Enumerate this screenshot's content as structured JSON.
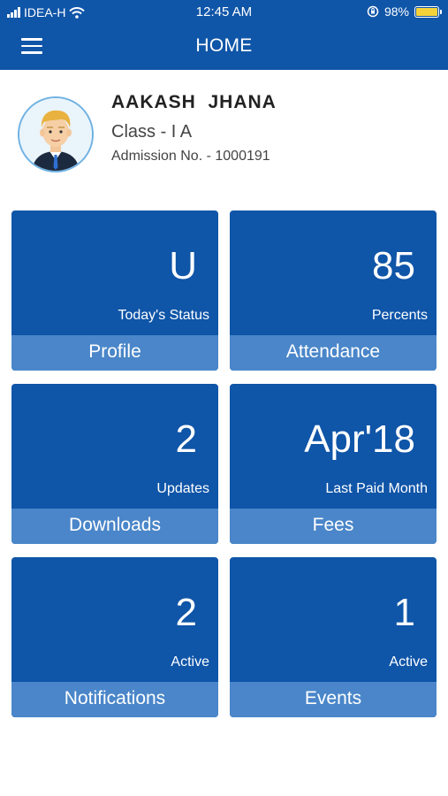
{
  "status_bar": {
    "carrier": "IDEA-H",
    "time": "12:45 AM",
    "battery_percent": "98%",
    "battery_level": 0.98
  },
  "header": {
    "title": "HOME",
    "menu_icon": "hamburger-menu-icon"
  },
  "profile": {
    "name": "AAKASH  JHANA",
    "class": "Class - I A",
    "admission": "Admission No. - 1000191",
    "avatar_icon": "student-avatar"
  },
  "tiles": [
    {
      "value": "U",
      "sub": "Today's Status",
      "label": "Profile"
    },
    {
      "value": "85",
      "sub": "Percents",
      "label": "Attendance"
    },
    {
      "value": "2",
      "sub": "Updates",
      "label": "Downloads"
    },
    {
      "value": "Apr'18",
      "sub": "Last Paid Month",
      "label": "Fees"
    },
    {
      "value": "2",
      "sub": "Active",
      "label": "Notifications"
    },
    {
      "value": "1",
      "sub": "Active",
      "label": "Events"
    }
  ],
  "colors": {
    "primary": "#0f55a8",
    "tile_bar": "#4a86c9",
    "battery": "#f5d23a"
  }
}
